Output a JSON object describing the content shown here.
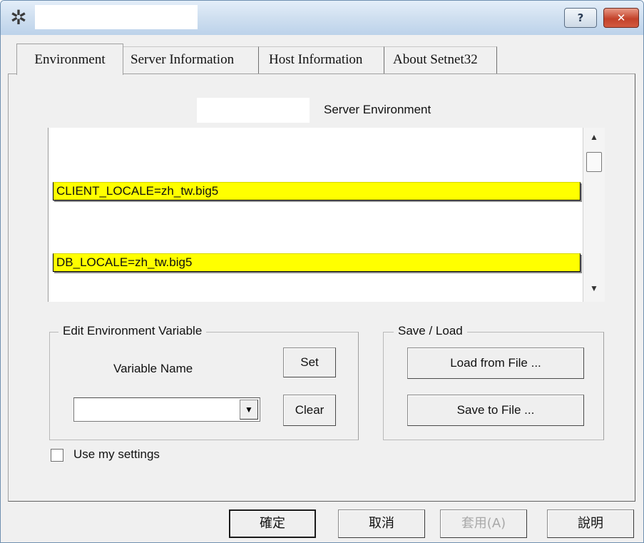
{
  "titlebar": {
    "app_icon": "setnet-app-icon",
    "help_label": "?",
    "close_label": "✕"
  },
  "tabs": [
    {
      "label": "Environment",
      "active": true
    },
    {
      "label": "Server Information",
      "active": false
    },
    {
      "label": "Host Information",
      "active": false
    },
    {
      "label": "About Setnet32",
      "active": false
    }
  ],
  "environment": {
    "header": "Server Environment",
    "variables": [
      {
        "text": "CLIENT_LOCALE=zh_tw.big5",
        "highlighted": true
      },
      {
        "text": "DB_LOCALE=zh_tw.big5",
        "highlighted": true
      }
    ],
    "highlight_color": "#ffff00"
  },
  "edit_group": {
    "title": "Edit Environment Variable",
    "variable_name_label": "Variable Name",
    "selected_value": "",
    "set_label": "Set",
    "clear_label": "Clear"
  },
  "save_group": {
    "title": "Save / Load",
    "load_label": "Load from File ...",
    "save_label": "Save to File ..."
  },
  "use_my_settings": {
    "label": "Use my settings",
    "checked": false
  },
  "dialog_buttons": {
    "ok": "確定",
    "cancel": "取消",
    "apply": "套用(A)",
    "help": "說明"
  }
}
